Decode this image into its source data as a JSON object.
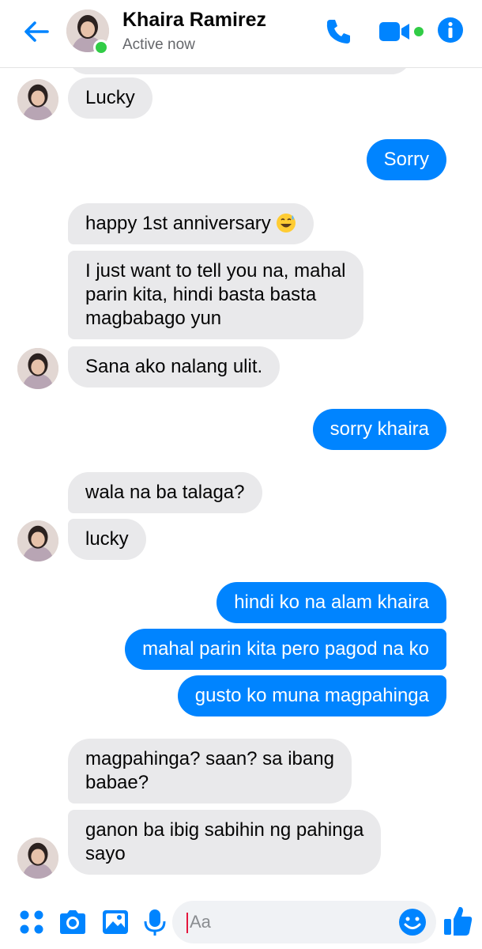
{
  "header": {
    "contact_name": "Khaira Ramirez",
    "status": "Active now",
    "accent_color": "#0084ff",
    "active_color": "#31cc46"
  },
  "messages": [
    {
      "side": "in",
      "text": "Lucky"
    },
    {
      "side": "out",
      "text": "Sorry"
    },
    {
      "side": "in",
      "text": "happy 1st anniversary",
      "emoji": "grinning-sweat-emoji"
    },
    {
      "side": "in",
      "text": "I just want to tell you na, mahal\nparin kita, hindi basta basta\nmagbabago yun"
    },
    {
      "side": "in",
      "text": "Sana ako nalang ulit."
    },
    {
      "side": "out",
      "text": "sorry khaira"
    },
    {
      "side": "in",
      "text": "wala na ba talaga?"
    },
    {
      "side": "in",
      "text": "lucky"
    },
    {
      "side": "out",
      "text": "hindi ko na alam khaira"
    },
    {
      "side": "out",
      "text": "mahal parin kita pero pagod na ko"
    },
    {
      "side": "out",
      "text": "gusto ko muna magpahinga"
    },
    {
      "side": "in",
      "text": "magpahinga? saan? sa ibang\nbabae?"
    },
    {
      "side": "in",
      "text": "ganon ba ibig sabihin ng pahinga\nsayo"
    }
  ],
  "composer": {
    "placeholder": "Aa",
    "icons": [
      "apps-icon",
      "camera-icon",
      "gallery-icon",
      "microphone-icon",
      "emoji-icon",
      "like-icon"
    ]
  }
}
